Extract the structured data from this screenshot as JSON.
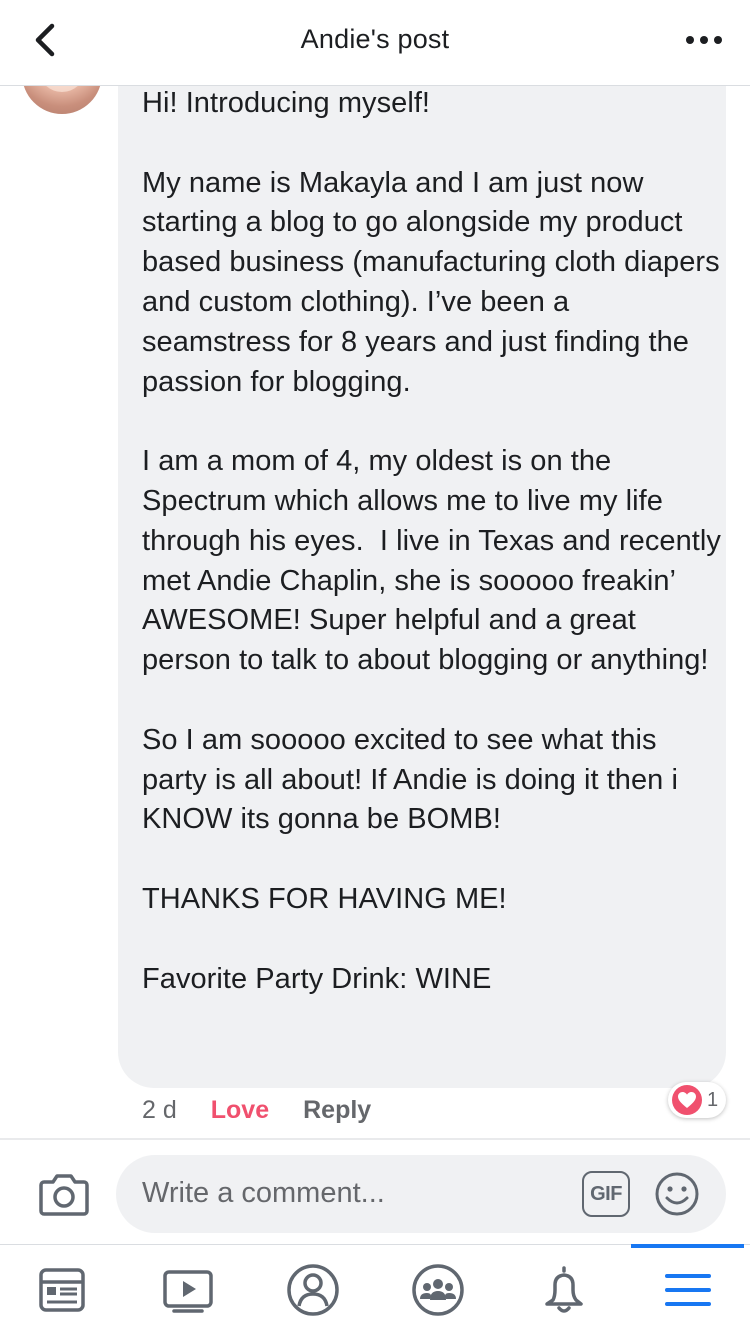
{
  "header": {
    "title": "Andie's post",
    "back_icon": "chevron-left-icon",
    "more_icon": "more-horizontal-icon"
  },
  "comment": {
    "text": "Hi! Introducing myself!\n\nMy name is Makayla and I am just now starting a blog to go alongside my product based business (manufacturing cloth diapers and custom clothing). I’ve been a seamstress for 8 years and just finding the passion for blogging.\n\nI am a mom of 4, my oldest is on the Spectrum which allows me to live my life through his eyes.  I live in Texas and recently met Andie Chaplin, she is sooooo freakin’ AWESOME! Super helpful and a great person to talk to about blogging or anything!\n\nSo I am sooooo excited to see what this party is all about! If Andie is doing it then i KNOW its gonna be BOMB!\n\nTHANKS FOR HAVING ME!\n\nFavorite Party Drink: WINE",
    "time": "2 d",
    "love_label": "Love",
    "reply_label": "Reply",
    "reaction_count": "1",
    "reaction_icon": "heart-icon"
  },
  "composer": {
    "placeholder": "Write a comment...",
    "gif_label": "GIF",
    "camera_icon": "camera-icon",
    "emoji_icon": "smiley-icon"
  },
  "tabs": [
    {
      "icon": "news-feed-icon",
      "active": false
    },
    {
      "icon": "watch-video-icon",
      "active": false
    },
    {
      "icon": "profile-icon",
      "active": false
    },
    {
      "icon": "groups-icon",
      "active": false
    },
    {
      "icon": "notifications-bell-icon",
      "active": false
    },
    {
      "icon": "menu-hamburger-icon",
      "active": true
    }
  ],
  "colors": {
    "accent": "#1877f2",
    "love": "#f0506e",
    "muted_text": "#65676b",
    "bubble_bg": "#f0f1f3"
  }
}
